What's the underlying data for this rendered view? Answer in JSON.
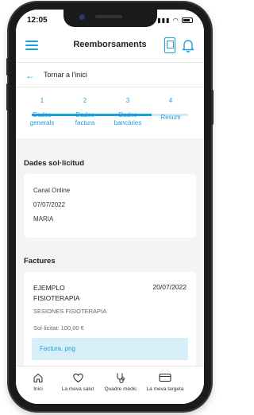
{
  "status": {
    "time": "12:05"
  },
  "header": {
    "title": "Reemborsaments"
  },
  "back": {
    "label": "Tornar a l'inici"
  },
  "steps": [
    {
      "num": "1",
      "label1": "Dades",
      "label2": "generals"
    },
    {
      "num": "2",
      "label1": "Dades",
      "label2": "factura"
    },
    {
      "num": "3",
      "label1": "Dades",
      "label2": "bancàries"
    },
    {
      "num": "4",
      "label1": "Resum",
      "label2": ""
    }
  ],
  "request": {
    "section_title": "Dades sol·licitud",
    "channel": "Canal Online",
    "date": "07/07/2022",
    "name": "MARIA"
  },
  "invoices": {
    "section_title": "Factures",
    "item": {
      "name_line1": "EJEMPLO",
      "name_line2": "FISIOTERAPIA",
      "date": "20/07/2022",
      "description": "SESIONES FISIOTERAPIA",
      "amount": "Sol·licitat: 100,00 €",
      "attachment": "Factura. png"
    }
  },
  "tabs": [
    {
      "label": "Inici",
      "icon": "home-icon"
    },
    {
      "label": "La meva salut",
      "icon": "heart-icon"
    },
    {
      "label": "Quadre mèdic",
      "icon": "stethoscope-icon"
    },
    {
      "label": "La meva targeta",
      "icon": "card-icon"
    }
  ],
  "colors": {
    "accent": "#1ba1d8",
    "attachment_bg": "#d8eef9",
    "background": "#f3f4f6"
  }
}
